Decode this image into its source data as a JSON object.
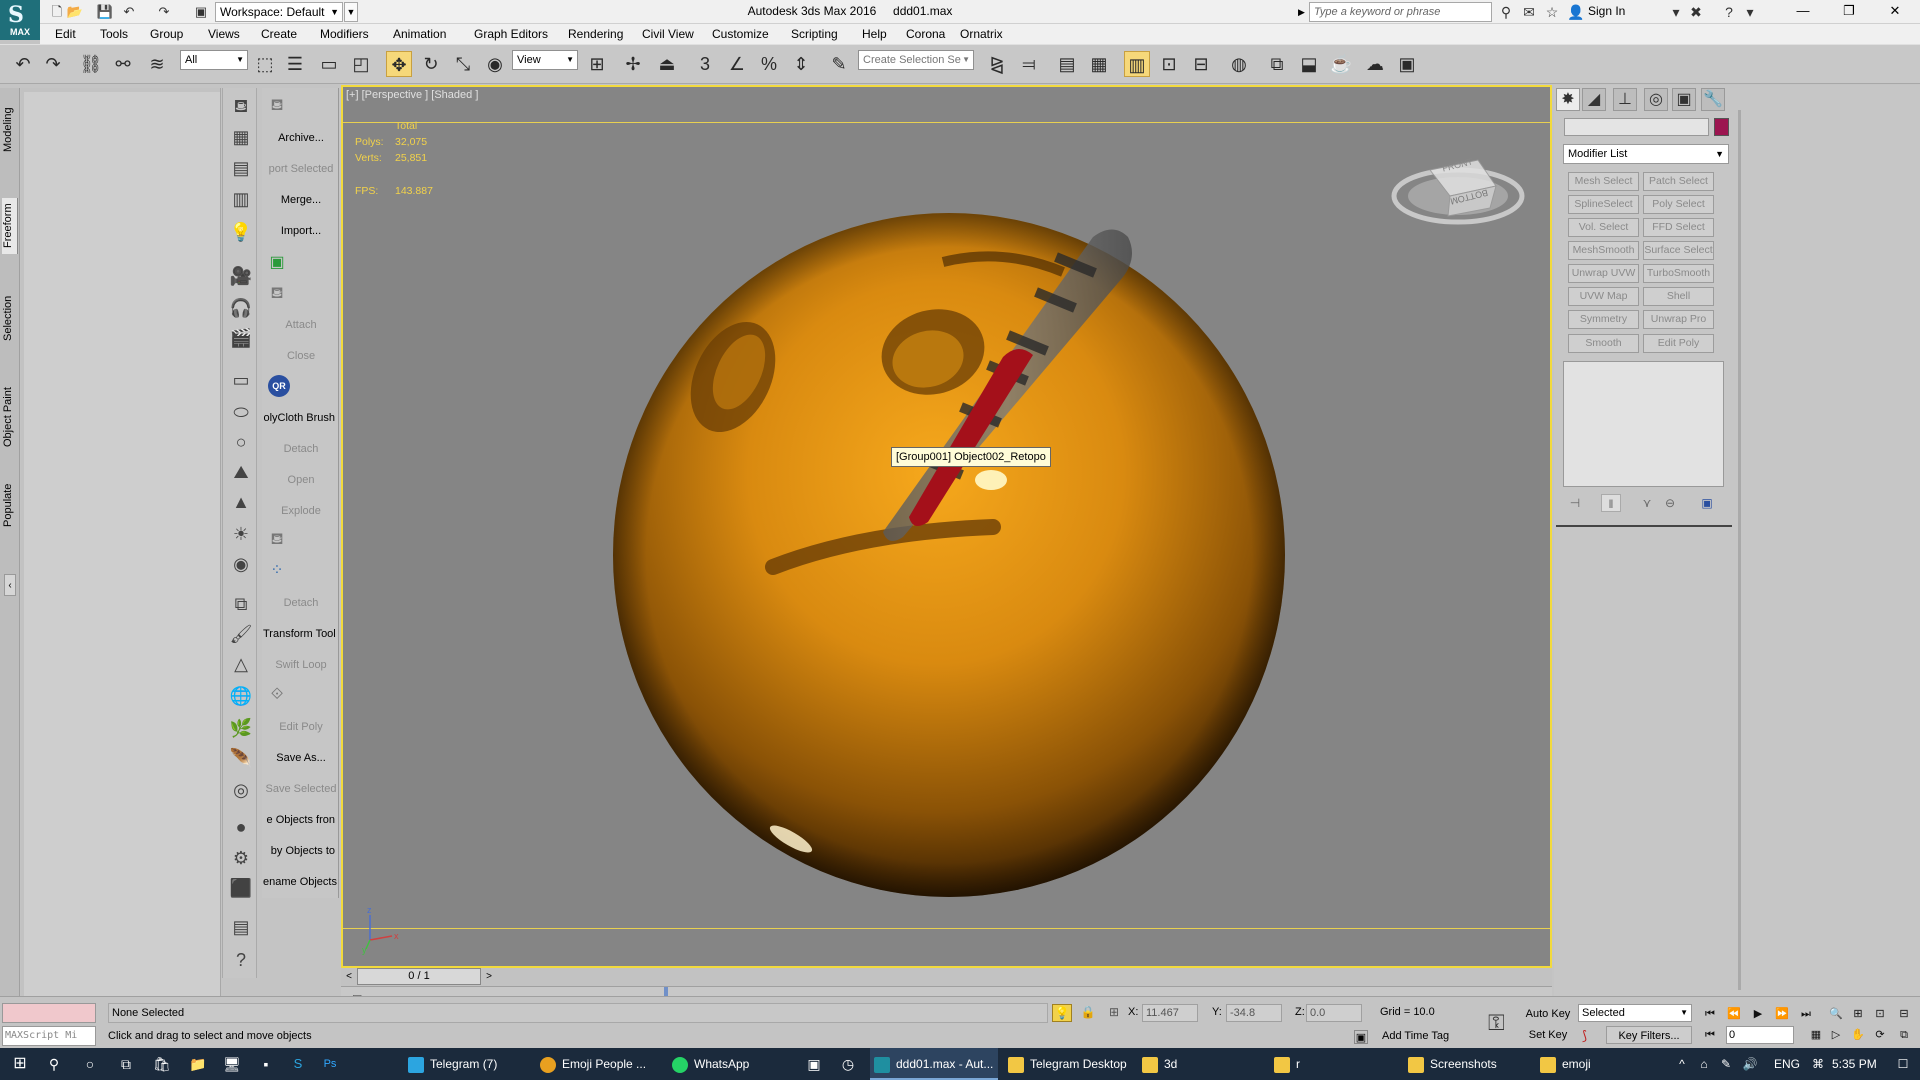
{
  "titlebar": {
    "workspace": "Workspace: Default",
    "app_title": "Autodesk 3ds Max 2016",
    "file_name": "ddd01.max",
    "search_placeholder": "Type a keyword or phrase",
    "sign_in": "Sign In"
  },
  "logo_label": "MAX",
  "menu": [
    "Edit",
    "Tools",
    "Group",
    "Views",
    "Create",
    "Modifiers",
    "Animation",
    "Graph Editors",
    "Rendering",
    "Civil View",
    "Customize",
    "Scripting",
    "Help",
    "Corona",
    "Ornatrix"
  ],
  "toolbar": {
    "filter": "All",
    "ref_coord": "View",
    "selection_set": "Create Selection Se",
    "snap_3": "3",
    "snap_angle": "∠",
    "snap_percent": "%"
  },
  "ribbon_tabs": [
    "Modeling",
    "Freeform",
    "Selection",
    "Object Paint",
    "Populate"
  ],
  "left_buttons": [
    {
      "label": "Archive...",
      "disabled": false
    },
    {
      "label": "port Selected",
      "disabled": true
    },
    {
      "label": "Merge...",
      "disabled": false
    },
    {
      "label": "Import...",
      "disabled": false
    },
    {
      "label": "Attach",
      "disabled": true
    },
    {
      "label": "Close",
      "disabled": true
    },
    {
      "label": "olyCloth Brush",
      "disabled": false
    },
    {
      "label": "Detach",
      "disabled": true
    },
    {
      "label": "Open",
      "disabled": true
    },
    {
      "label": "Explode",
      "disabled": true
    },
    {
      "label": "Detach",
      "disabled": true
    },
    {
      "label": "Transform Tool",
      "disabled": false
    },
    {
      "label": "Swift Loop",
      "disabled": true
    },
    {
      "label": "Edit Poly",
      "disabled": true
    },
    {
      "label": "Save As...",
      "disabled": false
    },
    {
      "label": "Save Selected",
      "disabled": true
    },
    {
      "label": "e Objects fron",
      "disabled": false
    },
    {
      "label": "by Objects to",
      "disabled": false
    },
    {
      "label": "ename Objects",
      "disabled": false
    }
  ],
  "viewport": {
    "label": "[+] [Perspective ] [Shaded ]",
    "stats_header": "Total",
    "polys_label": "Polys:",
    "polys_value": "32,075",
    "verts_label": "Verts:",
    "verts_value": "25,851",
    "fps_label": "FPS:",
    "fps_value": "143.887",
    "tooltip": "[Group001] Object002_Retopo",
    "viewcube_front": "FRONT",
    "viewcube_bottom": "BOTTOM",
    "axis_z": "z",
    "axis_x": "x",
    "axis_y": "y"
  },
  "timeline": {
    "position": "0 / 1",
    "prev": "<",
    "next": ">"
  },
  "command_panel": {
    "modifier_list": "Modifier List",
    "modifiers": [
      "Mesh Select",
      "Patch Select",
      "SplineSelect",
      "Poly Select",
      "Vol. Select",
      "FFD Select",
      "MeshSmooth",
      "Surface Select",
      "Unwrap UVW",
      "TurboSmooth",
      "UVW Map",
      "Shell",
      "Symmetry",
      "Unwrap Pro",
      "Smooth",
      "Edit Poly"
    ],
    "object_color": "#9c1550"
  },
  "status": {
    "maxscript_label": "MAXScript Mi",
    "selection": "None Selected",
    "prompt": "Click and drag to select and move objects",
    "x_label": "X:",
    "x_value": "11.467",
    "y_label": "Y:",
    "y_value": "-34.8",
    "z_label": "Z:",
    "z_value": "0.0",
    "grid": "Grid = 10.0",
    "add_time_tag": "Add Time Tag",
    "auto_key": "Auto Key",
    "set_key": "Set Key",
    "selected_combo": "Selected",
    "key_filters": "Key Filters...",
    "frame": "0"
  },
  "taskbar": {
    "items": [
      {
        "label": "Telegram (7)",
        "color": "#2ca5e0"
      },
      {
        "label": "Emoji People ...",
        "color": "#e8a020"
      },
      {
        "label": "WhatsApp",
        "color": "#25d366"
      },
      {
        "label": "ddd01.max - Aut...",
        "color": "#1f8fa0"
      },
      {
        "label": "Telegram Desktop",
        "color": "#f2c744"
      },
      {
        "label": "3d",
        "color": "#f2c744"
      },
      {
        "label": "r",
        "color": "#f2c744"
      },
      {
        "label": "Screenshots",
        "color": "#f2c744"
      },
      {
        "label": "emoji",
        "color": "#f2c744"
      }
    ],
    "lang": "ENG",
    "time": "5:35 PM"
  },
  "colors": {
    "viewport_border": "#f2da3c",
    "viewport_bg": "#858585",
    "stats_text": "#f2d24a",
    "sphere": "#d98a10"
  }
}
